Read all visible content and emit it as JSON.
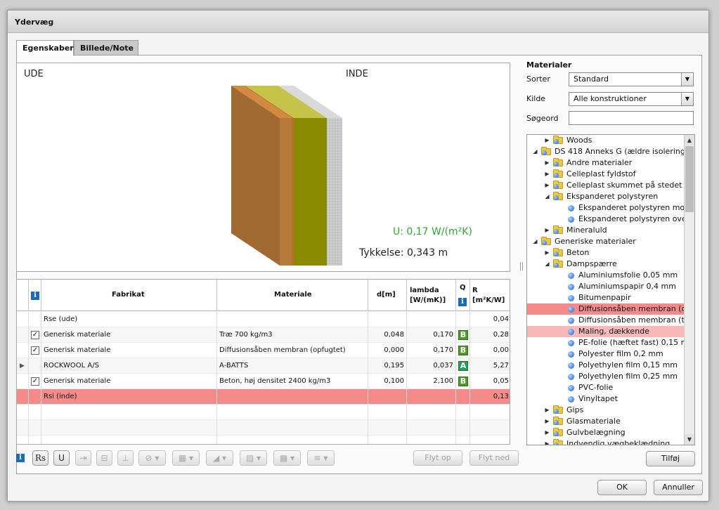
{
  "window": {
    "title": "Ydervæg"
  },
  "tabs": [
    {
      "label": "Egenskaber"
    },
    {
      "label": "Billede/Note"
    }
  ],
  "preview": {
    "outside_label": "UDE",
    "inside_label": "INDE",
    "u_value": "U:  0,17 W/(m²K)",
    "thickness": "Tykkelse:  0,343 m"
  },
  "table": {
    "headers": {
      "info": "i",
      "fabrikat": "Fabrikat",
      "materiale": "Materiale",
      "d": "d[m]",
      "lambda_1": "lambda",
      "lambda_2": "[W/(mK)]",
      "q": "Q",
      "r_1": "R",
      "r_2": "[m²K/W]"
    },
    "rows": [
      {
        "fabrikat": "Rse (ude)",
        "materiale": "",
        "d": "",
        "lambda": "",
        "q": "",
        "r": "0,04",
        "checked": false,
        "arrow": ""
      },
      {
        "fabrikat": "Generisk materiale",
        "materiale": "Træ 700 kg/m3",
        "d": "0,048",
        "lambda": "0,170",
        "q": "B",
        "r": "0,28",
        "checked": true,
        "arrow": ""
      },
      {
        "fabrikat": "Generisk materiale",
        "materiale": "Diffusionsåben membran (opfugtet)",
        "d": "0,000",
        "lambda": "0,170",
        "q": "B",
        "r": "0,00",
        "checked": true,
        "arrow": ""
      },
      {
        "fabrikat": "ROCKWOOL A/S",
        "materiale": "A-BATTS",
        "d": "0,195",
        "lambda": "0,037",
        "q": "A",
        "r": "5,27",
        "checked": false,
        "arrow": "▶"
      },
      {
        "fabrikat": "Generisk materiale",
        "materiale": "Beton, høj densitet 2400 kg/m3",
        "d": "0,100",
        "lambda": "2,100",
        "q": "B",
        "r": "0,05",
        "checked": true,
        "arrow": ""
      },
      {
        "fabrikat": "Rsi (inde)",
        "materiale": "",
        "d": "",
        "lambda": "",
        "q": "",
        "r": "0,13",
        "checked": false,
        "arrow": ""
      }
    ]
  },
  "toolbar": {
    "rs_label": "Rs",
    "u_label": "U",
    "move_up": "Flyt op",
    "move_down": "Flyt ned"
  },
  "materials": {
    "title": "Materialer",
    "sort_label": "Sorter",
    "sort_value": "Standard",
    "source_label": "Kilde",
    "source_value": "Alle konstruktioner",
    "search_label": "Søgeord",
    "search_value": "",
    "add_button": "Tilføj",
    "tree": [
      {
        "label": "Woods",
        "level": 1,
        "type": "folder",
        "state": "collapsed"
      },
      {
        "label": "DS 418 Anneks G (ældre isolering",
        "level": 0,
        "type": "folder",
        "state": "expanded"
      },
      {
        "label": "Andre materialer",
        "level": 1,
        "type": "folder",
        "state": "collapsed"
      },
      {
        "label": "Celleplast fyldstof",
        "level": 1,
        "type": "folder",
        "state": "collapsed"
      },
      {
        "label": "Celleplast skummet på stedet",
        "level": 1,
        "type": "folder",
        "state": "collapsed"
      },
      {
        "label": "Ekspanderet polystyren",
        "level": 1,
        "type": "folder",
        "state": "expanded"
      },
      {
        "label": "Ekspanderet polystyren mo",
        "level": 2,
        "type": "item",
        "state": ""
      },
      {
        "label": "Ekspanderet polystyren ove",
        "level": 2,
        "type": "item",
        "state": ""
      },
      {
        "label": "Mineraluld",
        "level": 1,
        "type": "folder",
        "state": "collapsed"
      },
      {
        "label": "Generiske materialer",
        "level": 0,
        "type": "folder",
        "state": "expanded"
      },
      {
        "label": "Beton",
        "level": 1,
        "type": "folder",
        "state": "collapsed"
      },
      {
        "label": "Dampspærre",
        "level": 1,
        "type": "folder",
        "state": "expanded"
      },
      {
        "label": "Aluminiumsfolie 0,05 mm",
        "level": 2,
        "type": "item",
        "state": ""
      },
      {
        "label": "Aluminiumspapir 0,4 mm",
        "level": 2,
        "type": "item",
        "state": ""
      },
      {
        "label": "Bitumenpapir",
        "level": 2,
        "type": "item",
        "state": ""
      },
      {
        "label": "Diffusionsåben membran (o",
        "level": 2,
        "type": "item",
        "state": "selected"
      },
      {
        "label": "Diffusionsåben membran (t",
        "level": 2,
        "type": "item",
        "state": ""
      },
      {
        "label": "Maling, dækkende",
        "level": 2,
        "type": "item",
        "state": "selected-light"
      },
      {
        "label": "PE-folie (hæftet fast) 0,15 r",
        "level": 2,
        "type": "item",
        "state": ""
      },
      {
        "label": "Polyester film 0,2 mm",
        "level": 2,
        "type": "item",
        "state": ""
      },
      {
        "label": "Polyethylen film 0,15 mm",
        "level": 2,
        "type": "item",
        "state": ""
      },
      {
        "label": "Polyethylen film 0,25 mm",
        "level": 2,
        "type": "item",
        "state": ""
      },
      {
        "label": "PVC-folie",
        "level": 2,
        "type": "item",
        "state": ""
      },
      {
        "label": "Vinyltapet",
        "level": 2,
        "type": "item",
        "state": ""
      },
      {
        "label": "Gips",
        "level": 1,
        "type": "folder",
        "state": "collapsed"
      },
      {
        "label": "Glasmateriale",
        "level": 1,
        "type": "folder",
        "state": "collapsed"
      },
      {
        "label": "Gulvbelægning",
        "level": 1,
        "type": "folder",
        "state": "collapsed"
      },
      {
        "label": "Indvendig vægbeklædning",
        "level": 1,
        "type": "folder",
        "state": "collapsed"
      }
    ]
  },
  "dialog": {
    "ok": "OK",
    "cancel": "Annuller"
  }
}
